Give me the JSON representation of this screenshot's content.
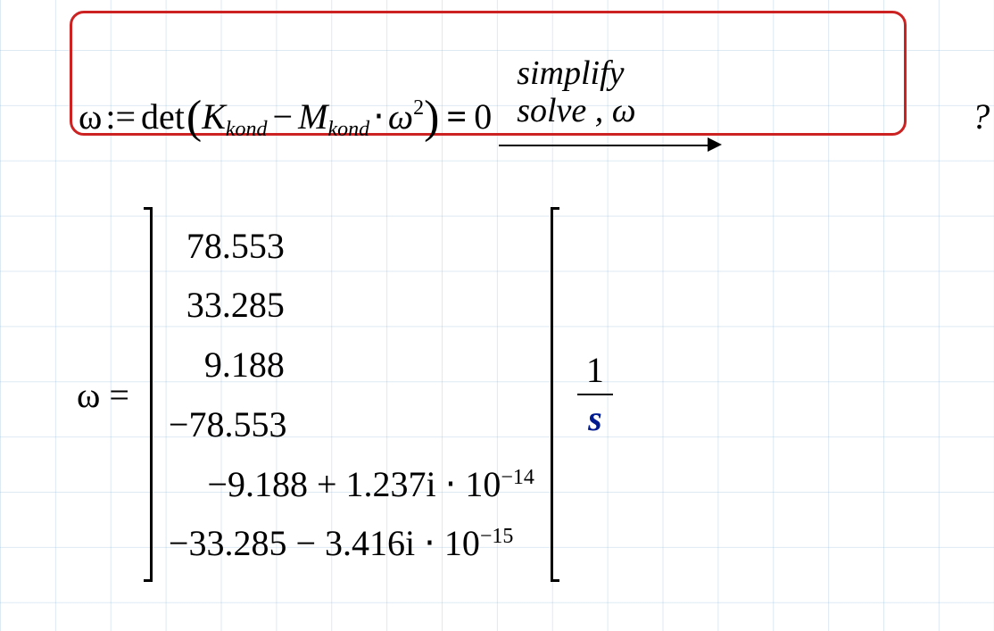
{
  "equation1": {
    "lhs_var": "ω",
    "assign_op": ":=",
    "det_label": "det",
    "K_var": "K",
    "K_sub": "kond",
    "minus": "−",
    "M_var": "M",
    "M_sub": "kond",
    "dot": "⋅",
    "omega_it": "ω",
    "omega_pow": "2",
    "eq_op": "=",
    "rhs_zero": "0",
    "simplify": "simplify",
    "solve": "solve , ω",
    "result_placeholder": "?"
  },
  "equation2": {
    "lhs_var": "ω",
    "eq_op": "=",
    "rows": [
      "78.553",
      "33.285",
      "9.188",
      "−78.553",
      "−9.188 + 1.237i ⋅ 10",
      "−33.285 − 3.416i ⋅ 10"
    ],
    "row5_exp": "−14",
    "row6_exp": "−15",
    "unit_num": "1",
    "unit_den": "s"
  }
}
